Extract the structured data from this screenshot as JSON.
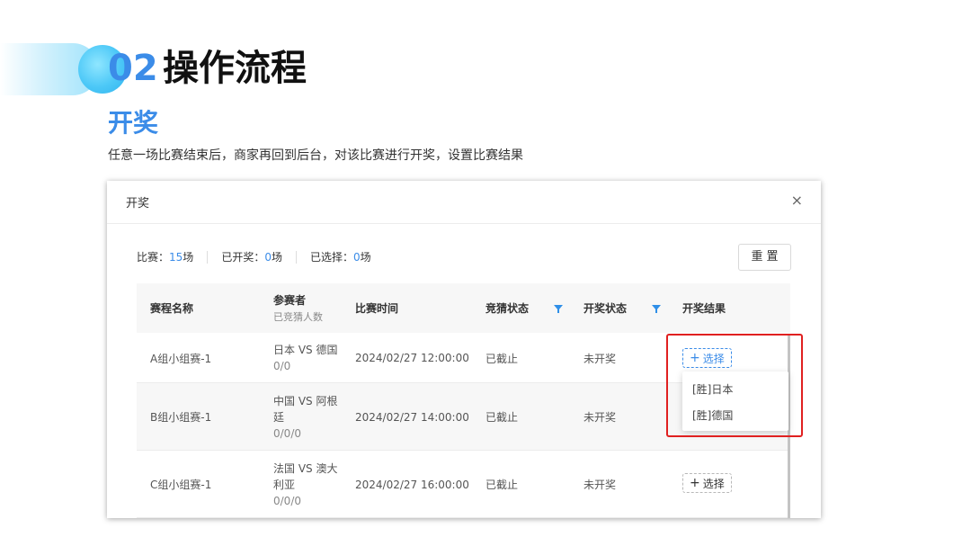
{
  "slide": {
    "section_number": "02",
    "section_title": "操作流程",
    "sub_heading": "开奖",
    "description": "任意一场比赛结束后，商家再回到后台，对该比赛进行开奖，设置比赛结果"
  },
  "dialog": {
    "title": "开奖",
    "close_glyph": "×",
    "stats": {
      "matches_label": "比赛：",
      "matches_value": "15",
      "matches_unit": "场",
      "drawn_label": "已开奖：",
      "drawn_value": "0",
      "drawn_unit": "场",
      "selected_label": "已选择：",
      "selected_value": "0",
      "selected_unit": "场"
    },
    "reset_label": "重置",
    "columns": {
      "name": "赛程名称",
      "participants": "参赛者",
      "participants_sub": "已竞猜人数",
      "time": "比赛时间",
      "guess_status": "竞猜状态",
      "draw_status": "开奖状态",
      "result": "开奖结果"
    },
    "rows": [
      {
        "name": "A组小组赛-1",
        "teams": "日本 VS 德国",
        "teams_line2": "",
        "count": "0/0",
        "time": "2024/02/27 12:00:00",
        "guess_status": "已截止",
        "draw_status": "未开奖",
        "select_label": "选择"
      },
      {
        "name": "B组小组赛-1",
        "teams": "中国 VS 阿根",
        "teams_line2": "廷",
        "count": "0/0/0",
        "time": "2024/02/27 14:00:00",
        "guess_status": "已截止",
        "draw_status": "未开奖",
        "select_label": ""
      },
      {
        "name": "C组小组赛-1",
        "teams": "法国 VS 澳大",
        "teams_line2": "利亚",
        "count": "0/0/0",
        "time": "2024/02/27 16:00:00",
        "guess_status": "已截止",
        "draw_status": "未开奖",
        "select_label": "选择"
      }
    ],
    "dropdown_options": [
      "[胜]日本",
      "[胜]德国"
    ]
  },
  "colors": {
    "accent": "#3b8ce8",
    "highlight": "#e02020",
    "filter_icon": "#2f8fe8"
  },
  "icons": {
    "close": "close-icon",
    "filter": "filter-icon",
    "plus": "plus-icon"
  }
}
